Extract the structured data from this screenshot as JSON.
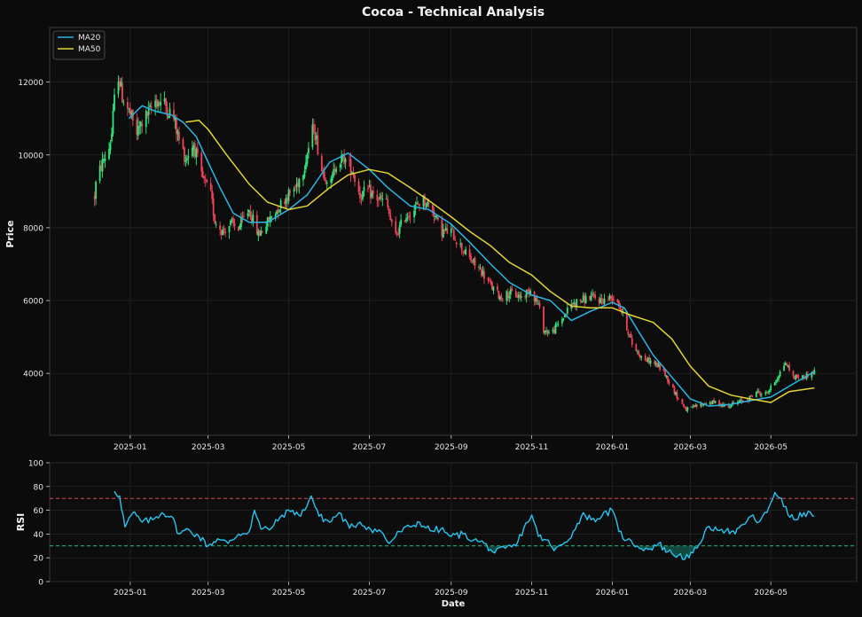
{
  "chart_data": [
    {
      "type": "candlestick",
      "title": "Cocoa - Technical Analysis",
      "xlabel": "",
      "ylabel": "Price",
      "ylim": [
        2300,
        13500
      ],
      "yticks": [
        4000,
        6000,
        8000,
        10000,
        12000
      ],
      "xlim": [
        "2024-11-01",
        "2026-07-05"
      ],
      "xticks": [
        "2025-01-01",
        "2025-03-01",
        "2025-05-01",
        "2025-07-01",
        "2025-09-01",
        "2025-11-01",
        "2026-01-01",
        "2026-03-01",
        "2026-05-01"
      ],
      "xtick_labels": [
        "2025-01",
        "2025-03",
        "2025-05",
        "2025-07",
        "2025-09",
        "2025-11",
        "2026-01",
        "2026-03",
        "2026-05"
      ],
      "grid": true,
      "legend": "top-left",
      "colors": {
        "up": "#2ee87a",
        "down": "#f0445a",
        "ma20": "#29b6e6",
        "ma50": "#e2d534",
        "background": "#0b0b0b"
      },
      "price_path": [
        [
          "2024-12-05",
          8850
        ],
        [
          "2024-12-06",
          9200
        ],
        [
          "2024-12-10",
          9700
        ],
        [
          "2024-12-16",
          10200
        ],
        [
          "2024-12-18",
          10600
        ],
        [
          "2024-12-20",
          11500
        ],
        [
          "2024-12-23",
          12200
        ],
        [
          "2024-12-26",
          11600
        ],
        [
          "2024-12-31",
          11200
        ],
        [
          "2025-01-06",
          10600
        ],
        [
          "2025-01-10",
          10900
        ],
        [
          "2025-01-16",
          11200
        ],
        [
          "2025-01-20",
          11500
        ],
        [
          "2025-01-27",
          11400
        ],
        [
          "2025-02-03",
          11000
        ],
        [
          "2025-02-07",
          10400
        ],
        [
          "2025-02-12",
          9900
        ],
        [
          "2025-02-18",
          10300
        ],
        [
          "2025-02-24",
          9400
        ],
        [
          "2025-03-03",
          8900
        ],
        [
          "2025-03-06",
          8200
        ],
        [
          "2025-03-12",
          7900
        ],
        [
          "2025-03-18",
          8100
        ],
        [
          "2025-03-24",
          8000
        ],
        [
          "2025-04-01",
          8500
        ],
        [
          "2025-04-08",
          7800
        ],
        [
          "2025-04-14",
          8100
        ],
        [
          "2025-04-20",
          8400
        ],
        [
          "2025-04-28",
          8800
        ],
        [
          "2025-05-06",
          9100
        ],
        [
          "2025-05-12",
          9600
        ],
        [
          "2025-05-20",
          10800
        ],
        [
          "2025-05-26",
          9600
        ],
        [
          "2025-06-02",
          9200
        ],
        [
          "2025-06-06",
          9800
        ],
        [
          "2025-06-12",
          9900
        ],
        [
          "2025-06-18",
          9600
        ],
        [
          "2025-06-24",
          8900
        ],
        [
          "2025-06-30",
          9000
        ],
        [
          "2025-07-07",
          8800
        ],
        [
          "2025-07-14",
          8700
        ],
        [
          "2025-07-20",
          7700
        ],
        [
          "2025-07-28",
          8300
        ],
        [
          "2025-08-04",
          8500
        ],
        [
          "2025-08-10",
          8800
        ],
        [
          "2025-08-18",
          8500
        ],
        [
          "2025-08-24",
          7900
        ],
        [
          "2025-09-01",
          7900
        ],
        [
          "2025-09-08",
          7500
        ],
        [
          "2025-09-16",
          7100
        ],
        [
          "2025-09-24",
          6800
        ],
        [
          "2025-10-01",
          6400
        ],
        [
          "2025-10-08",
          6100
        ],
        [
          "2025-10-16",
          6200
        ],
        [
          "2025-10-24",
          6100
        ],
        [
          "2025-10-31",
          6300
        ],
        [
          "2025-11-06",
          5900
        ],
        [
          "2025-11-10",
          5200
        ],
        [
          "2025-11-16",
          5100
        ],
        [
          "2025-11-24",
          5500
        ],
        [
          "2025-12-01",
          5900
        ],
        [
          "2025-12-08",
          6000
        ],
        [
          "2025-12-16",
          6100
        ],
        [
          "2025-12-24",
          6000
        ],
        [
          "2026-01-01",
          6100
        ],
        [
          "2026-01-05",
          6000
        ],
        [
          "2026-01-10",
          5500
        ],
        [
          "2026-01-16",
          4800
        ],
        [
          "2026-01-24",
          4400
        ],
        [
          "2026-02-01",
          4300
        ],
        [
          "2026-02-08",
          4100
        ],
        [
          "2026-02-14",
          3700
        ],
        [
          "2026-02-20",
          3300
        ],
        [
          "2026-02-26",
          3000
        ],
        [
          "2026-03-06",
          3100
        ],
        [
          "2026-03-14",
          3200
        ],
        [
          "2026-03-20",
          3200
        ],
        [
          "2026-03-28",
          3100
        ],
        [
          "2026-04-06",
          3200
        ],
        [
          "2026-04-14",
          3300
        ],
        [
          "2026-04-20",
          3500
        ],
        [
          "2026-04-26",
          3400
        ],
        [
          "2026-05-01",
          3600
        ],
        [
          "2026-05-06",
          3900
        ],
        [
          "2026-05-12",
          4300
        ],
        [
          "2026-05-18",
          3900
        ],
        [
          "2026-05-26",
          3900
        ],
        [
          "2026-06-03",
          4050
        ]
      ],
      "series": [
        {
          "name": "MA20",
          "points": [
            [
              "2024-12-31",
              11000
            ],
            [
              "2025-01-10",
              11350
            ],
            [
              "2025-01-20",
              11200
            ],
            [
              "2025-02-01",
              11100
            ],
            [
              "2025-02-10",
              10900
            ],
            [
              "2025-02-20",
              10500
            ],
            [
              "2025-03-01",
              9800
            ],
            [
              "2025-03-10",
              9100
            ],
            [
              "2025-03-20",
              8400
            ],
            [
              "2025-04-01",
              8150
            ],
            [
              "2025-04-15",
              8150
            ],
            [
              "2025-05-01",
              8500
            ],
            [
              "2025-05-15",
              8900
            ],
            [
              "2025-06-01",
              9800
            ],
            [
              "2025-06-15",
              10050
            ],
            [
              "2025-07-01",
              9600
            ],
            [
              "2025-07-15",
              9100
            ],
            [
              "2025-08-01",
              8600
            ],
            [
              "2025-08-15",
              8500
            ],
            [
              "2025-09-01",
              8100
            ],
            [
              "2025-09-15",
              7600
            ],
            [
              "2025-10-01",
              7000
            ],
            [
              "2025-10-15",
              6500
            ],
            [
              "2025-11-01",
              6150
            ],
            [
              "2025-11-15",
              6000
            ],
            [
              "2025-12-01",
              5450
            ],
            [
              "2025-12-15",
              5700
            ],
            [
              "2026-01-01",
              5950
            ],
            [
              "2026-01-10",
              5800
            ],
            [
              "2026-01-20",
              5200
            ],
            [
              "2026-02-01",
              4500
            ],
            [
              "2026-02-15",
              3900
            ],
            [
              "2026-03-01",
              3300
            ],
            [
              "2026-03-15",
              3100
            ],
            [
              "2026-04-01",
              3150
            ],
            [
              "2026-04-15",
              3250
            ],
            [
              "2026-05-01",
              3350
            ],
            [
              "2026-05-15",
              3650
            ],
            [
              "2026-06-03",
              4050
            ]
          ]
        },
        {
          "name": "MA50",
          "points": [
            [
              "2025-02-12",
              10900
            ],
            [
              "2025-02-22",
              10950
            ],
            [
              "2025-03-01",
              10700
            ],
            [
              "2025-03-15",
              10000
            ],
            [
              "2025-04-01",
              9200
            ],
            [
              "2025-04-15",
              8700
            ],
            [
              "2025-05-01",
              8500
            ],
            [
              "2025-05-15",
              8600
            ],
            [
              "2025-06-01",
              9100
            ],
            [
              "2025-06-15",
              9450
            ],
            [
              "2025-07-01",
              9600
            ],
            [
              "2025-07-15",
              9500
            ],
            [
              "2025-08-01",
              9100
            ],
            [
              "2025-08-15",
              8750
            ],
            [
              "2025-09-01",
              8300
            ],
            [
              "2025-09-15",
              7900
            ],
            [
              "2025-10-01",
              7500
            ],
            [
              "2025-10-15",
              7050
            ],
            [
              "2025-11-01",
              6700
            ],
            [
              "2025-11-15",
              6250
            ],
            [
              "2025-12-01",
              5850
            ],
            [
              "2025-12-15",
              5800
            ],
            [
              "2026-01-01",
              5800
            ],
            [
              "2026-01-15",
              5600
            ],
            [
              "2026-02-01",
              5400
            ],
            [
              "2026-02-15",
              4950
            ],
            [
              "2026-03-01",
              4200
            ],
            [
              "2026-03-15",
              3650
            ],
            [
              "2026-04-01",
              3400
            ],
            [
              "2026-04-15",
              3300
            ],
            [
              "2026-05-01",
              3200
            ],
            [
              "2026-05-15",
              3500
            ],
            [
              "2026-06-03",
              3600
            ]
          ]
        }
      ]
    },
    {
      "type": "line",
      "xlabel": "Date",
      "ylabel": "RSI",
      "ylim": [
        0,
        100
      ],
      "yticks": [
        0,
        20,
        40,
        60,
        80,
        100
      ],
      "xlim": [
        "2024-11-01",
        "2026-07-05"
      ],
      "xticks": [
        "2025-01-01",
        "2025-03-01",
        "2025-05-01",
        "2025-07-01",
        "2025-09-01",
        "2025-11-01",
        "2026-01-01",
        "2026-03-01",
        "2026-05-01"
      ],
      "xtick_labels": [
        "2025-01",
        "2025-03",
        "2025-05",
        "2025-07",
        "2025-09",
        "2025-11",
        "2026-01",
        "2026-03",
        "2026-05"
      ],
      "overbought": 70,
      "oversold": 30,
      "colors": {
        "line": "#29c3f0",
        "overbought": "#e0474f",
        "oversold": "#24c384",
        "fill": "#16806a"
      },
      "series": [
        {
          "name": "RSI",
          "points": [
            [
              "2024-12-20",
              76
            ],
            [
              "2024-12-24",
              72
            ],
            [
              "2024-12-28",
              46
            ],
            [
              "2025-01-03",
              58
            ],
            [
              "2025-01-10",
              50
            ],
            [
              "2025-01-18",
              52
            ],
            [
              "2025-01-25",
              58
            ],
            [
              "2025-02-01",
              55
            ],
            [
              "2025-02-07",
              40
            ],
            [
              "2025-02-14",
              44
            ],
            [
              "2025-02-22",
              38
            ],
            [
              "2025-03-01",
              30
            ],
            [
              "2025-03-08",
              36
            ],
            [
              "2025-03-16",
              32
            ],
            [
              "2025-03-24",
              40
            ],
            [
              "2025-04-01",
              42
            ],
            [
              "2025-04-05",
              60
            ],
            [
              "2025-04-10",
              44
            ],
            [
              "2025-04-18",
              45
            ],
            [
              "2025-04-26",
              56
            ],
            [
              "2025-05-04",
              60
            ],
            [
              "2025-05-10",
              55
            ],
            [
              "2025-05-18",
              72
            ],
            [
              "2025-05-24",
              55
            ],
            [
              "2025-06-01",
              50
            ],
            [
              "2025-06-08",
              58
            ],
            [
              "2025-06-16",
              45
            ],
            [
              "2025-06-24",
              50
            ],
            [
              "2025-07-02",
              44
            ],
            [
              "2025-07-10",
              42
            ],
            [
              "2025-07-16",
              32
            ],
            [
              "2025-07-24",
              42
            ],
            [
              "2025-08-01",
              46
            ],
            [
              "2025-08-08",
              50
            ],
            [
              "2025-08-16",
              43
            ],
            [
              "2025-08-24",
              44
            ],
            [
              "2025-09-01",
              38
            ],
            [
              "2025-09-10",
              40
            ],
            [
              "2025-09-18",
              35
            ],
            [
              "2025-09-26",
              32
            ],
            [
              "2025-10-04",
              24
            ],
            [
              "2025-10-12",
              28
            ],
            [
              "2025-10-20",
              30
            ],
            [
              "2025-10-26",
              45
            ],
            [
              "2025-11-01",
              56
            ],
            [
              "2025-11-06",
              38
            ],
            [
              "2025-11-12",
              35
            ],
            [
              "2025-11-18",
              26
            ],
            [
              "2025-11-26",
              33
            ],
            [
              "2025-12-04",
              44
            ],
            [
              "2025-12-10",
              58
            ],
            [
              "2025-12-16",
              52
            ],
            [
              "2025-12-24",
              55
            ],
            [
              "2026-01-01",
              60
            ],
            [
              "2026-01-06",
              42
            ],
            [
              "2026-01-12",
              35
            ],
            [
              "2026-01-20",
              30
            ],
            [
              "2026-01-28",
              27
            ],
            [
              "2026-02-05",
              32
            ],
            [
              "2026-02-12",
              25
            ],
            [
              "2026-02-20",
              22
            ],
            [
              "2026-02-28",
              20
            ],
            [
              "2026-03-06",
              28
            ],
            [
              "2026-03-12",
              42
            ],
            [
              "2026-03-20",
              46
            ],
            [
              "2026-03-28",
              43
            ],
            [
              "2026-04-04",
              40
            ],
            [
              "2026-04-10",
              48
            ],
            [
              "2026-04-16",
              55
            ],
            [
              "2026-04-22",
              50
            ],
            [
              "2026-04-28",
              58
            ],
            [
              "2026-05-04",
              75
            ],
            [
              "2026-05-09",
              70
            ],
            [
              "2026-05-14",
              56
            ],
            [
              "2026-05-20",
              52
            ],
            [
              "2026-05-26",
              58
            ],
            [
              "2026-06-03",
              55
            ]
          ]
        }
      ]
    }
  ]
}
